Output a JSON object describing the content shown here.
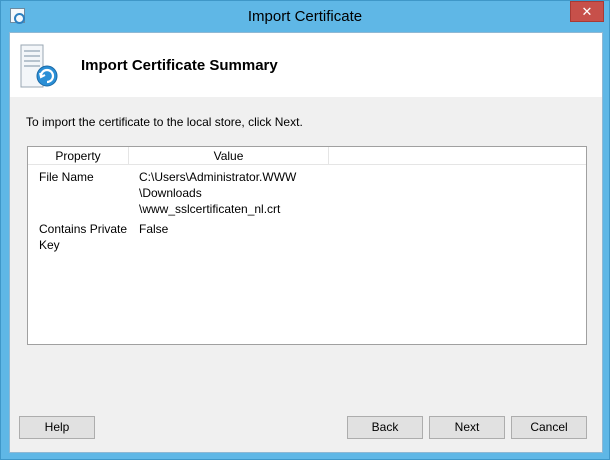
{
  "window": {
    "title": "Import Certificate",
    "close_glyph": "✕"
  },
  "header": {
    "title": "Import Certificate Summary",
    "icon": "certificate-import-icon"
  },
  "instruction": "To import the certificate to the local store, click Next.",
  "table": {
    "columns": [
      "Property",
      "Value",
      ""
    ],
    "rows": [
      {
        "property": [
          "File Name"
        ],
        "value": [
          "C:\\Users\\Administrator.WWW",
          "\\Downloads",
          "\\www_sslcertificaten_nl.crt"
        ]
      },
      {
        "property": [
          "Contains Private",
          "Key"
        ],
        "value": [
          "False"
        ]
      }
    ]
  },
  "buttons": {
    "help": "Help",
    "back": "Back",
    "next": "Next",
    "cancel": "Cancel"
  },
  "colors": {
    "title_bar": "#5fb7e6",
    "close_button": "#c7504a",
    "dialog_bg": "#f0f0f0"
  }
}
